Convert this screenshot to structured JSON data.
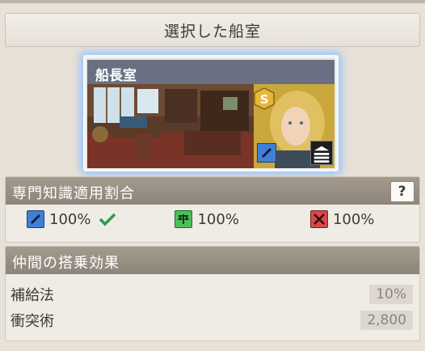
{
  "header": {
    "title": "選択した船室"
  },
  "cabin": {
    "name": "船長室"
  },
  "expertise": {
    "title": "専門知識適用割合",
    "help_label": "?",
    "rates": [
      {
        "icon": "pen-icon",
        "value": "100%",
        "color": "#3f7fd8",
        "check": true
      },
      {
        "icon": "scales-icon",
        "value": "100%",
        "color": "#4cbf5a",
        "check": false
      },
      {
        "icon": "swords-icon",
        "value": "100%",
        "color": "#d64a4a",
        "check": false
      }
    ]
  },
  "crew_effect": {
    "title": "仲間の搭乗効果",
    "rows": [
      {
        "label": "補給法",
        "value": "10%"
      },
      {
        "label": "衝突術",
        "value": "2,800"
      }
    ]
  }
}
